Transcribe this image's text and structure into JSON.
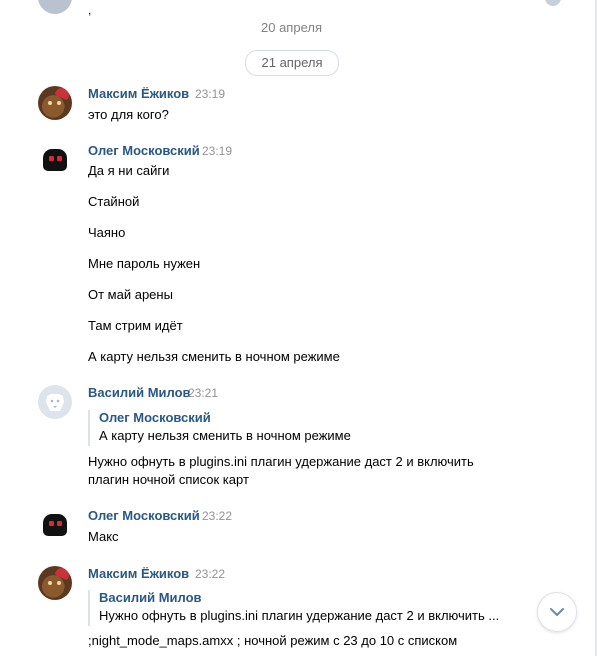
{
  "top_fragment": ",",
  "dates": {
    "previous": "20 апреля",
    "current": "21 апреля"
  },
  "messages": [
    {
      "author": "Максим Ёжиков",
      "time": "23:19",
      "avatar": "maxim-avatar",
      "lines": [
        "это для кого?"
      ]
    },
    {
      "author": "Олег Московский",
      "time": "23:19",
      "avatar": "oleg-avatar",
      "lines": [
        "Да я ни сайги",
        "Стайной",
        "Чаяно",
        "Мне пароль нужен",
        "От май арены",
        "Там стрим идёт",
        "А карту нельзя сменить в ночном режиме"
      ]
    },
    {
      "author": "Василий Милов",
      "time": "23:21",
      "avatar": "vk-default-avatar",
      "reply": {
        "author": "Олег Московский",
        "text": "А карту нельзя сменить в ночном режиме"
      },
      "lines": [
        "Нужно офнуть в plugins.ini плагин удержание даст 2 и включить",
        "плагин ночной список карт"
      ]
    },
    {
      "author": "Олег Московский",
      "time": "23:22",
      "avatar": "oleg-avatar",
      "lines": [
        "Макс"
      ]
    },
    {
      "author": "Максим Ёжиков",
      "time": "23:22",
      "avatar": "maxim-avatar",
      "reply": {
        "author": "Василий Милов",
        "text": "Нужно офнуть в plugins.ini плагин удержание даст 2 и включить ..."
      },
      "lines": [
        ";night_mode_maps.amxx ; ночной режим с 23 до 10 с списком"
      ]
    }
  ],
  "scroll_button": {
    "icon": "chevron-down-icon"
  },
  "colors": {
    "author": "#2a5885",
    "time": "#939393",
    "date": "#828282",
    "reply_border": "#dae2ea"
  }
}
